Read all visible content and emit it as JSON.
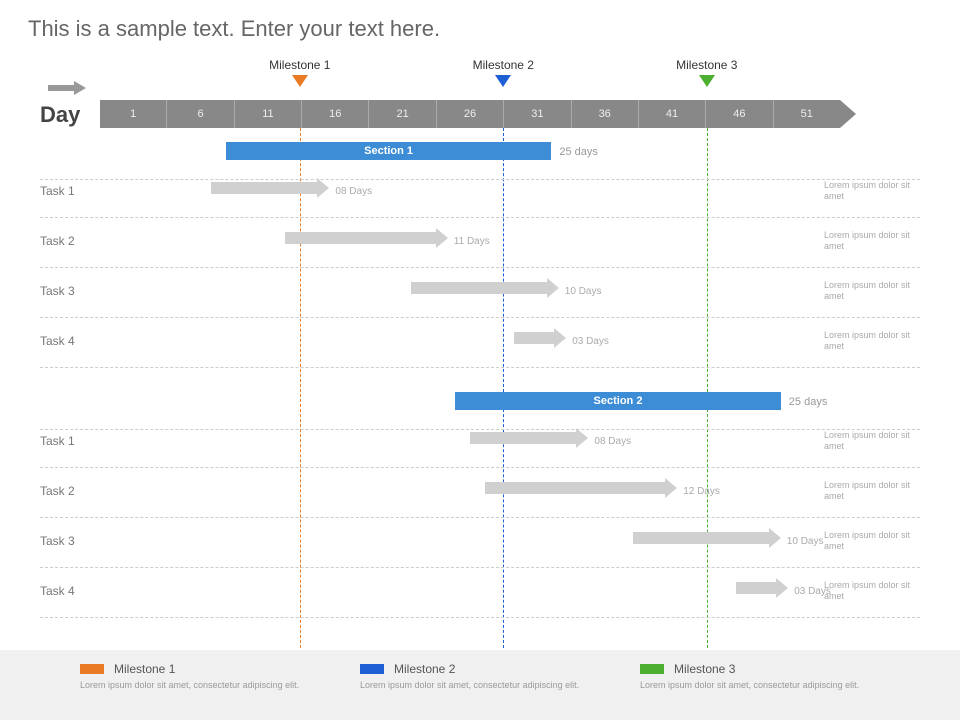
{
  "title": "This is a sample text. Enter your text here.",
  "axis_label": "Day",
  "axis_ticks": [
    "1",
    "6",
    "11",
    "16",
    "21",
    "26",
    "31",
    "36",
    "41",
    "46",
    "51"
  ],
  "milestones": [
    {
      "label": "Milestone 1",
      "color": "#e87b24",
      "pos_pct": 27
    },
    {
      "label": "Milestone 2",
      "color": "#1e5fd6",
      "pos_pct": 54.5
    },
    {
      "label": "Milestone 3",
      "color": "#4caf2f",
      "pos_pct": 82
    }
  ],
  "rows": [
    {
      "type": "section",
      "label": "",
      "bar_label": "Section 1",
      "duration": "25 days",
      "left_pct": 17,
      "width_pct": 44,
      "note": ""
    },
    {
      "type": "task",
      "label": "Task 1",
      "duration": "08 Days",
      "left_pct": 15,
      "width_pct": 16,
      "note": "Lorem ipsum dolor sit amet"
    },
    {
      "type": "task",
      "label": "Task 2",
      "duration": "11 Days",
      "left_pct": 25,
      "width_pct": 22,
      "note": "Lorem ipsum dolor sit amet"
    },
    {
      "type": "task",
      "label": "Task 3",
      "duration": "10 Days",
      "left_pct": 42,
      "width_pct": 20,
      "note": "Lorem ipsum dolor sit amet"
    },
    {
      "type": "task",
      "label": "Task 4",
      "duration": "03 Days",
      "left_pct": 56,
      "width_pct": 7,
      "note": "Lorem ipsum dolor sit amet"
    },
    {
      "type": "section",
      "label": "",
      "bar_label": "Section 2",
      "duration": "25 days",
      "left_pct": 48,
      "width_pct": 44,
      "note": ""
    },
    {
      "type": "task",
      "label": "Task 1",
      "duration": "08 Days",
      "left_pct": 50,
      "width_pct": 16,
      "note": "Lorem ipsum dolor sit amet"
    },
    {
      "type": "task",
      "label": "Task 2",
      "duration": "12 Days",
      "left_pct": 52,
      "width_pct": 26,
      "note": "Lorem ipsum dolor sit amet"
    },
    {
      "type": "task",
      "label": "Task 3",
      "duration": "10 Days",
      "left_pct": 72,
      "width_pct": 20,
      "note": "Lorem ipsum dolor sit amet"
    },
    {
      "type": "task",
      "label": "Task 4",
      "duration": "03 Days",
      "left_pct": 86,
      "width_pct": 7,
      "note": "Lorem ipsum dolor sit amet"
    }
  ],
  "legend": [
    {
      "label": "Milestone 1",
      "color": "#e87b24",
      "desc": "Lorem ipsum dolor sit amet, consectetur adipiscing elit."
    },
    {
      "label": "Milestone 2",
      "color": "#1e5fd6",
      "desc": "Lorem ipsum dolor sit amet, consectetur adipiscing elit."
    },
    {
      "label": "Milestone 3",
      "color": "#4caf2f",
      "desc": "Lorem ipsum dolor sit amet, consectetur adipiscing elit."
    }
  ]
}
